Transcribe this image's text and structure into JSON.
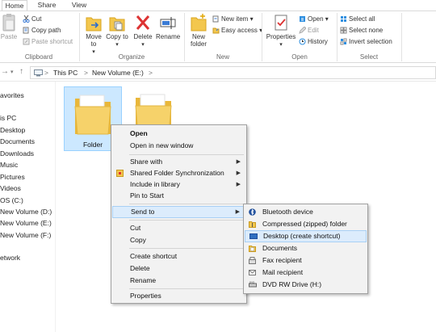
{
  "ribbon": {
    "tabs": [
      "Home",
      "Share",
      "View"
    ],
    "clipboard": {
      "paste": "Paste",
      "cut": "Cut",
      "copy_path": "Copy path",
      "paste_shortcut": "Paste shortcut",
      "label": "Clipboard"
    },
    "organize": {
      "move_to": "Move to",
      "copy_to": "Copy to",
      "delete": "Delete",
      "rename": "Rename",
      "label": "Organize"
    },
    "new": {
      "new_folder": "New folder",
      "new_item": "New item",
      "easy_access": "Easy access",
      "label": "New"
    },
    "open": {
      "properties": "Properties",
      "open": "Open",
      "edit": "Edit",
      "history": "History",
      "label": "Open"
    },
    "select": {
      "select_all": "Select all",
      "select_none": "Select none",
      "invert_selection": "Invert selection",
      "label": "Select"
    }
  },
  "address": {
    "crumbs": [
      "This PC",
      "New Volume (E:)"
    ],
    "separator": ">"
  },
  "nav": {
    "items": [
      "avorites",
      "is PC",
      "Desktop",
      "Documents",
      "Downloads",
      "Music",
      "Pictures",
      "Videos",
      "OS (C:)",
      "New Volume (D:)",
      "New Volume (E:)",
      "New Volume (F:)",
      "etwork"
    ]
  },
  "content": {
    "folders": [
      "Folder",
      ""
    ]
  },
  "context_menu": {
    "items": [
      "Open",
      "Open in new window",
      "Share with",
      "Shared Folder Synchronization",
      "Include in library",
      "Pin to Start",
      "Send to",
      "Cut",
      "Copy",
      "Create shortcut",
      "Delete",
      "Rename",
      "Properties"
    ]
  },
  "send_to_menu": {
    "items": [
      "Bluetooth device",
      "Compressed (zipped) folder",
      "Desktop (create shortcut)",
      "Documents",
      "Fax recipient",
      "Mail recipient",
      "DVD RW Drive (H:)"
    ]
  },
  "colors": {
    "folder": "#f3c74e",
    "selection": "#cce8ff",
    "menu_bg": "#f2f2f2",
    "highlight": "#dcecfc"
  }
}
